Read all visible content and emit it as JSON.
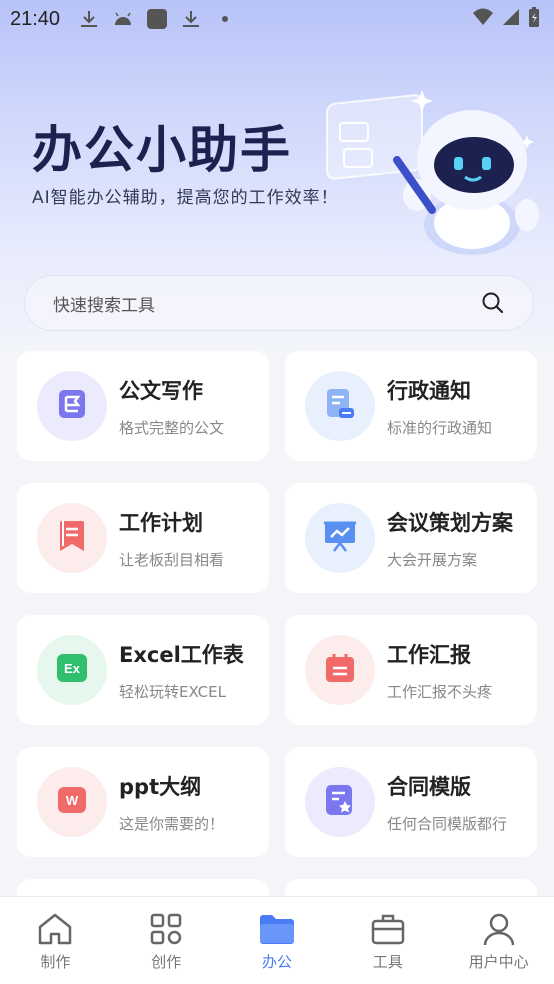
{
  "status_bar": {
    "time": "21:40"
  },
  "hero": {
    "title": "办公小助手",
    "subtitle": "AI智能办公辅助，提高您的工作效率！"
  },
  "search": {
    "placeholder": "快速搜索工具"
  },
  "tools": [
    {
      "title": "公文写作",
      "desc": "格式完整的公文",
      "icon": "document-flag-icon",
      "color": "#7b77f0",
      "bg": "#ecebfd"
    },
    {
      "title": "行政通知",
      "desc": "标准的行政通知",
      "icon": "notice-doc-icon",
      "color": "#5a8ff2",
      "bg": "#e8f0fd"
    },
    {
      "title": "工作计划",
      "desc": "让老板刮目相看",
      "icon": "bookmark-plan-icon",
      "color": "#f06a6a",
      "bg": "#fdecec"
    },
    {
      "title": "会议策划方案",
      "desc": "大会开展方案",
      "icon": "presentation-icon",
      "color": "#5a8ff2",
      "bg": "#e8f0fd"
    },
    {
      "title": "Excel工作表",
      "desc": "轻松玩转EXCEL",
      "icon": "excel-icon",
      "color": "#2fbf6e",
      "bg": "#e6f8ee"
    },
    {
      "title": "工作汇报",
      "desc": "工作汇报不头疼",
      "icon": "calendar-report-icon",
      "color": "#f06a6a",
      "bg": "#fdecec"
    },
    {
      "title": "ppt大纲",
      "desc": "这是你需要的！",
      "icon": "ppt-icon",
      "color": "#f06a6a",
      "bg": "#fdecec"
    },
    {
      "title": "合同模版",
      "desc": "任何合同模版都行",
      "icon": "contract-star-icon",
      "color": "#7b77f0",
      "bg": "#ecebfd"
    }
  ],
  "tabbar": {
    "items": [
      {
        "label": "制作",
        "icon": "home-icon"
      },
      {
        "label": "创作",
        "icon": "grid-apps-icon"
      },
      {
        "label": "办公",
        "icon": "folder-icon",
        "active": true
      },
      {
        "label": "工具",
        "icon": "briefcase-icon"
      },
      {
        "label": "用户中心",
        "icon": "user-icon"
      }
    ],
    "active_color": "#4a7cf6"
  }
}
